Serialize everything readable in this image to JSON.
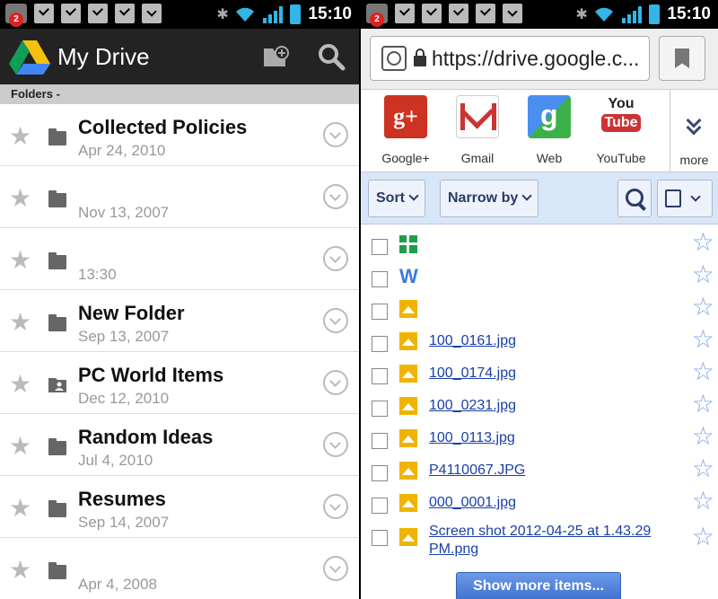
{
  "status_bar": {
    "notification_count": "2",
    "time": "15:10"
  },
  "drive_app": {
    "title": "My Drive",
    "section_header": "Folders -",
    "folders": [
      {
        "name": "Collected Policies",
        "date": "Apr 24, 2010",
        "icon": "folder-icon"
      },
      {
        "name": "",
        "date": "Nov 13, 2007",
        "icon": "folder-icon"
      },
      {
        "name": "",
        "date": "13:30",
        "icon": "folder-icon"
      },
      {
        "name": "New Folder",
        "date": "Sep 13, 2007",
        "icon": "folder-icon"
      },
      {
        "name": "PC World Items",
        "date": "Dec 12, 2010",
        "icon": "shared-folder-icon"
      },
      {
        "name": "Random Ideas",
        "date": "Jul 4, 2010",
        "icon": "folder-icon"
      },
      {
        "name": "Resumes",
        "date": "Sep 14, 2007",
        "icon": "folder-icon"
      },
      {
        "name": "",
        "date": "Apr 4, 2008",
        "icon": "folder-icon"
      }
    ]
  },
  "browser": {
    "url": "https://drive.google.c...",
    "shortcuts": [
      {
        "label": "Google+",
        "icon": "google-plus-icon"
      },
      {
        "label": "Gmail",
        "icon": "gmail-icon"
      },
      {
        "label": "Web",
        "icon": "web-icon"
      },
      {
        "label": "YouTube",
        "icon": "youtube-icon"
      }
    ],
    "youtube_you": "You",
    "youtube_tube": "Tube",
    "gplus_glyph": "g+",
    "more_label": "more",
    "toolbar": {
      "sort_label": "Sort",
      "narrow_label": "Narrow by"
    },
    "files": [
      {
        "name": "",
        "type": "spreadsheet"
      },
      {
        "name": "",
        "type": "document"
      },
      {
        "name": "",
        "type": "image"
      },
      {
        "name": "100_0161.jpg",
        "type": "image"
      },
      {
        "name": "100_0174.jpg",
        "type": "image"
      },
      {
        "name": "100_0231.jpg",
        "type": "image"
      },
      {
        "name": "100_0113.jpg",
        "type": "image"
      },
      {
        "name": "P4110067.JPG",
        "type": "image"
      },
      {
        "name": "000_0001.jpg",
        "type": "image"
      },
      {
        "name": "Screen shot 2012-04-25 at 1.43.29 PM.png",
        "type": "image"
      }
    ],
    "show_more_label": "Show more items..."
  },
  "colors": {
    "drive_appbar": "#232323",
    "toolbar_bg": "#d9e6f8",
    "link_blue": "#1a3fa8",
    "button_blue": "#3f72d0"
  }
}
